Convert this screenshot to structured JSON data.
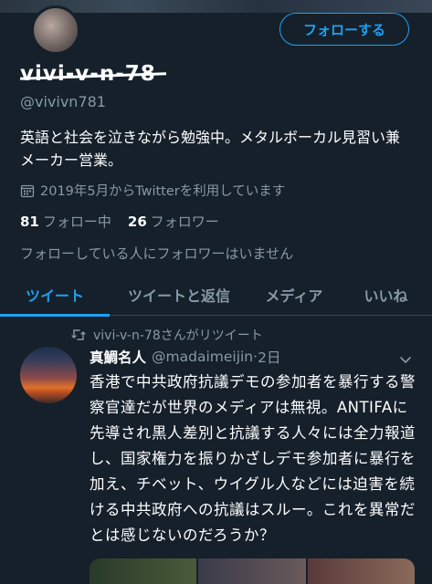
{
  "profile": {
    "display_name": "vivi-v-n-78",
    "handle": "@vivivn781",
    "follow_label": "フォローする",
    "bio": "英語と社会を泣きながら勉強中。メタルボーカル見習い兼メーカー営業。",
    "joined": "2019年5月からTwitterを利用しています",
    "following_count": "81",
    "following_label": "フォロー中",
    "followers_count": "26",
    "followers_label": "フォロワー",
    "no_mutual_followers": "フォローしている人にフォロワーはいません"
  },
  "tabs": [
    {
      "label": "ツイート",
      "active": true
    },
    {
      "label": "ツイートと返信",
      "active": false
    },
    {
      "label": "メディア",
      "active": false
    },
    {
      "label": "いいね",
      "active": false
    }
  ],
  "tweet": {
    "retweet_label": "vivi-v-n-78さんがリツイート",
    "author_name": "真鯛名人",
    "author_handle": "@madaimeijin",
    "time": "2日",
    "body": "香港で中共政府抗議デモの参加者を暴行する警察官達だが世界のメディアは無視。ANTIFAに先導され黒人差別と抗議する人々には全力報道し、国家権力を振りかざしデモ参加者に暴行を加え、チベット、ウイグル人などには迫害を続ける中共政府への抗議はスルー。これを異常だとは感じないのだろうか？"
  },
  "colors": {
    "background": "#15202b",
    "accent": "#1da1f2",
    "secondary_text": "#8899a6",
    "divider": "#38444d"
  },
  "icons": {
    "calendar": "calendar-icon",
    "retweet": "retweet-icon",
    "chevron": "chevron-down-icon"
  }
}
